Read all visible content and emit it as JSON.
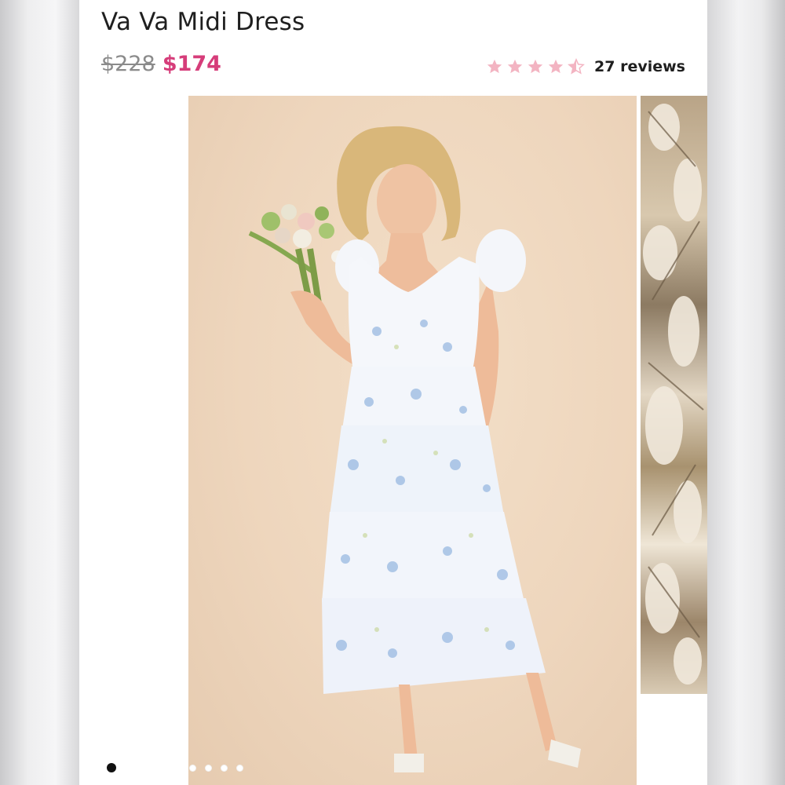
{
  "product": {
    "title": "Va Va Midi Dress",
    "price_original": "$228",
    "price_sale": "$174"
  },
  "rating": {
    "stars": 4.5,
    "reviews_label": "27 reviews",
    "star_color": "#f3b4c2"
  },
  "colors": {
    "sale_price": "#d63d7a",
    "original_price": "#8b8b8b",
    "background": "#f0dcc6"
  },
  "gallery": {
    "current_index": 0,
    "total_images": 5
  }
}
